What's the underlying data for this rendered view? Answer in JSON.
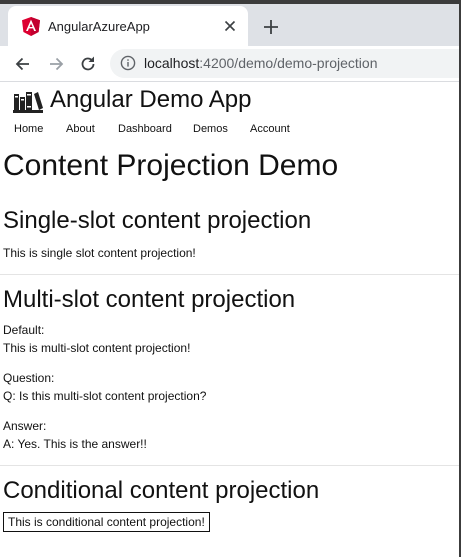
{
  "browser": {
    "tab_title": "AngularAzureApp",
    "url_host": "localhost",
    "url_path": ":4200/demo/demo-projection"
  },
  "app": {
    "title": "Angular Demo App",
    "nav": [
      "Home",
      "About",
      "Dashboard",
      "Demos",
      "Account"
    ]
  },
  "content": {
    "page_title": "Content Projection Demo",
    "single": {
      "heading": "Single-slot content projection",
      "text": "This is single slot content projection!"
    },
    "multi": {
      "heading": "Multi-slot content projection",
      "default_label": "Default:",
      "default_text": "This is multi-slot content projection!",
      "question_label": "Question:",
      "question_text": "Q: Is this multi-slot content projection?",
      "answer_label": "Answer:",
      "answer_text": "A: Yes. This is the answer!!"
    },
    "conditional": {
      "heading": "Conditional content projection",
      "text": "This is conditional content projection!"
    }
  },
  "colors": {
    "angular_red": "#dd0031",
    "tabstrip": "#dee1e6",
    "omnibox": "#f1f3f4"
  },
  "icons": [
    "angular-favicon",
    "close-icon",
    "plus-icon",
    "back-arrow-icon",
    "forward-arrow-icon",
    "reload-icon",
    "info-icon",
    "books-logo"
  ]
}
